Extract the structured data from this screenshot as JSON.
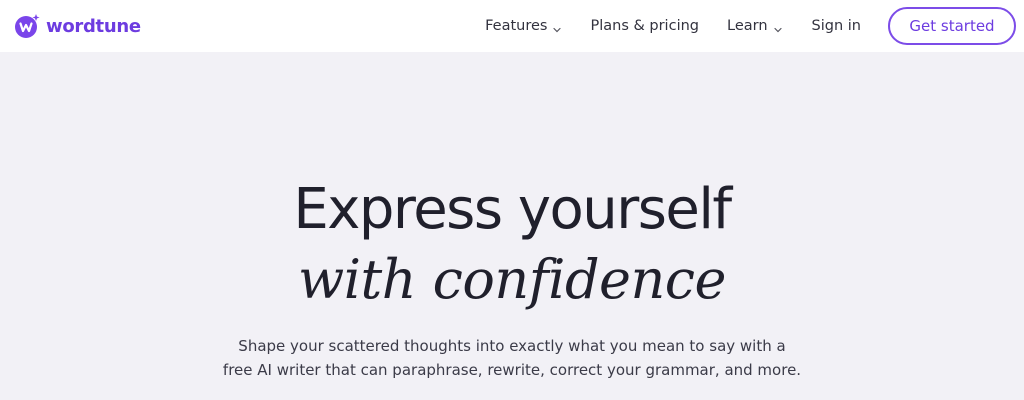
{
  "brand": {
    "name": "wordtune",
    "accent_color": "#6d3ce0",
    "logo_icon": "wordtune-logo-icon"
  },
  "nav": {
    "items": [
      {
        "label": "Features",
        "has_dropdown": true
      },
      {
        "label": "Plans & pricing",
        "has_dropdown": false
      },
      {
        "label": "Learn",
        "has_dropdown": true
      },
      {
        "label": "Sign in",
        "has_dropdown": false
      }
    ],
    "cta_label": "Get started"
  },
  "hero": {
    "headline_line1": "Express yourself",
    "headline_line2": "with confidence",
    "subtext_line1": "Shape your scattered thoughts into exactly what you mean to say with a",
    "subtext_line2": "free AI writer that can paraphrase, rewrite, correct your grammar, and more.",
    "background_color": "#f2f1f6"
  }
}
